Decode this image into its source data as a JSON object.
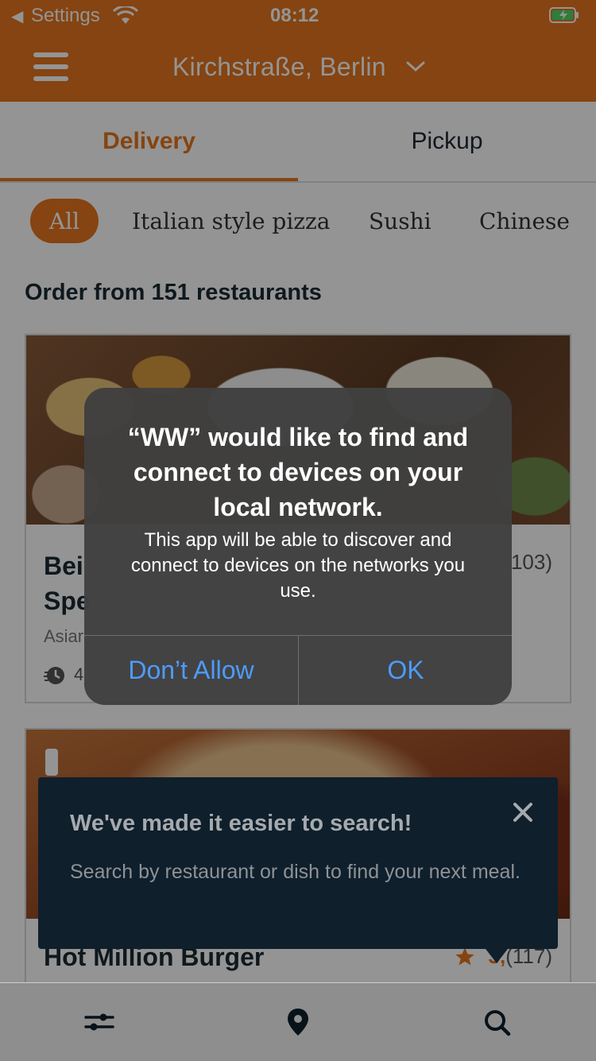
{
  "status_bar": {
    "back_label": "Settings",
    "time": "08:12"
  },
  "header": {
    "location": "Kirchstraße, Berlin"
  },
  "tabs": [
    {
      "label": "Delivery",
      "active": true
    },
    {
      "label": "Pickup",
      "active": false
    }
  ],
  "categories": [
    {
      "label": "All",
      "selected": true
    },
    {
      "label": "Italian style pizza"
    },
    {
      "label": "Sushi"
    },
    {
      "label": "Chinese"
    }
  ],
  "restaurants": {
    "heading": "Order from 151 restaurants",
    "items": [
      {
        "name": "Bei\nSpe",
        "rating": "103)",
        "cuisine": "Asiar",
        "eta": "4"
      },
      {
        "name": "Hot Million Burger",
        "rating_value": "3,",
        "rating_count": "(117)"
      }
    ]
  },
  "tooltip": {
    "title": "We've made it easier to search!",
    "text": "Search by restaurant or dish to find your next meal."
  },
  "alert": {
    "title": "“WW” would like to find and connect to devices on your local network.",
    "message": "This app will be able to discover and connect to devices on the networks you use.",
    "buttons": {
      "deny": "Don’t Allow",
      "ok": "OK"
    }
  },
  "colors": {
    "brand": "#e5761e",
    "alert_button": "#4d9cff",
    "tooltip_bg": "#0f1f2b"
  }
}
